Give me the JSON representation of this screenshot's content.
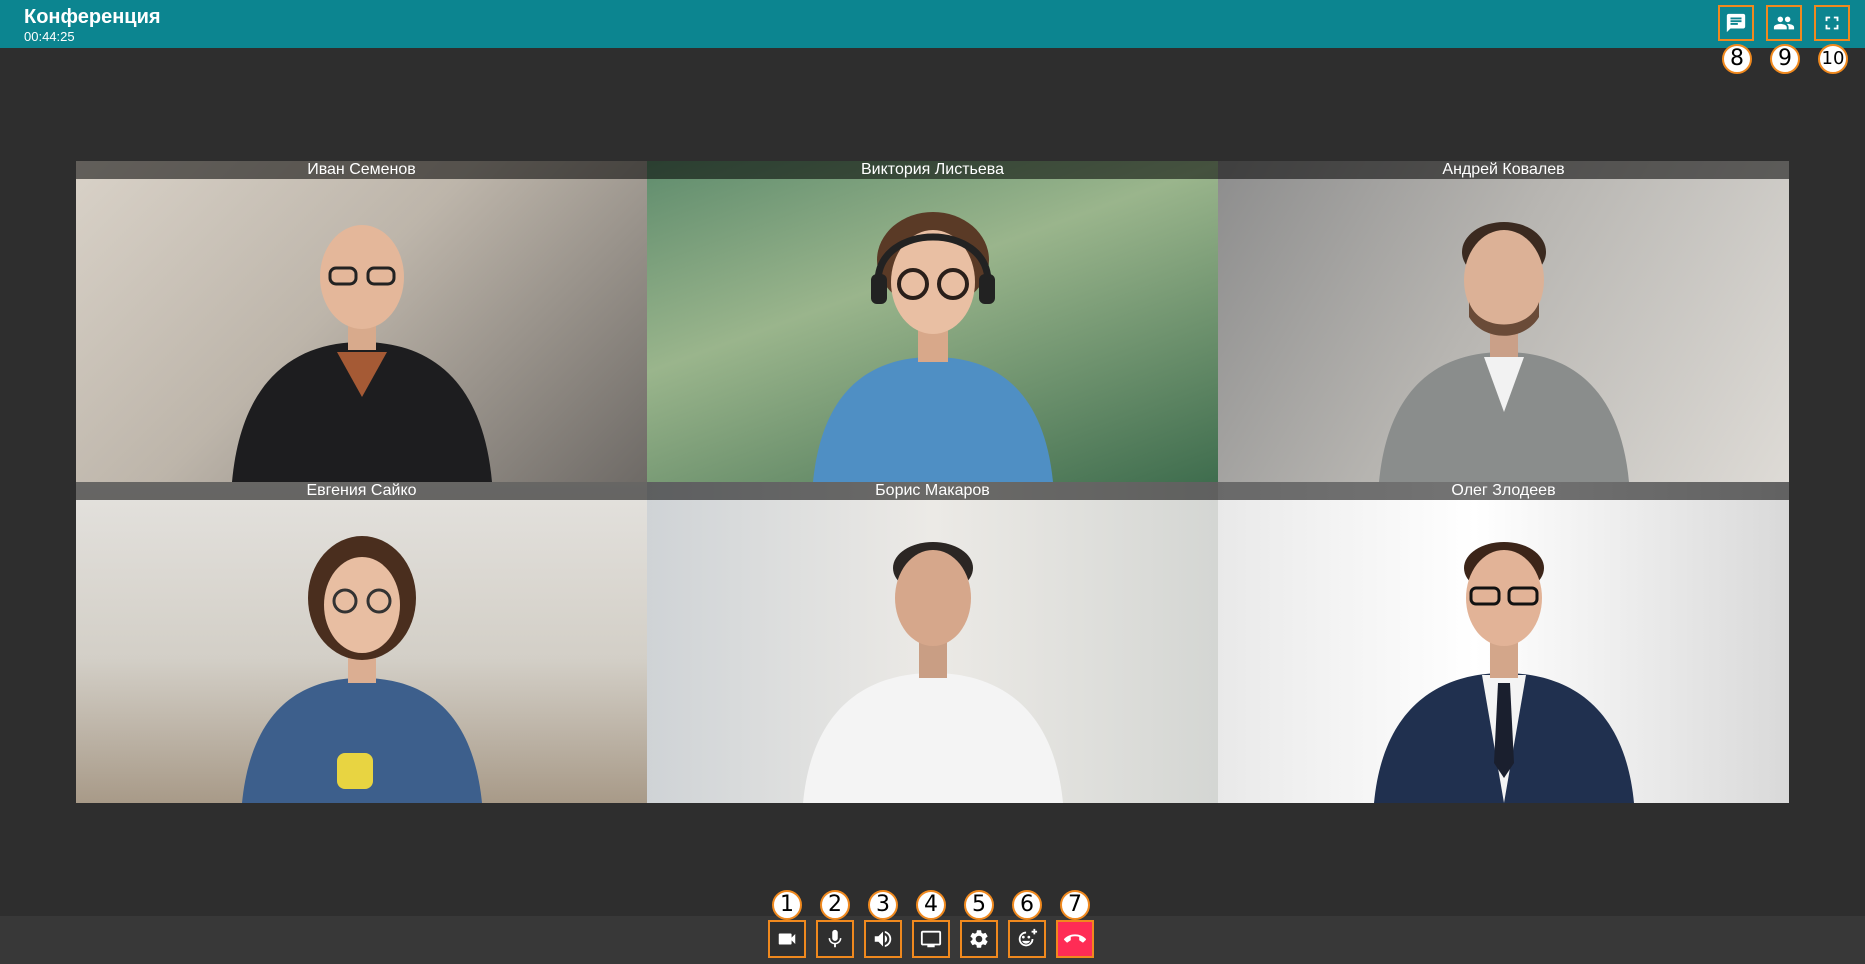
{
  "header": {
    "title": "Конференция",
    "elapsed": "00:44:25",
    "buttons": [
      {
        "id": "chat",
        "icon": "chat-icon",
        "marker": "8"
      },
      {
        "id": "participants",
        "icon": "people-icon",
        "marker": "9"
      },
      {
        "id": "fullscreen",
        "icon": "fullscreen-icon",
        "marker": "10"
      }
    ]
  },
  "participants": [
    {
      "name": "Иван Семенов"
    },
    {
      "name": "Виктория Листьева"
    },
    {
      "name": "Андрей Ковалев"
    },
    {
      "name": "Евгения Сайко"
    },
    {
      "name": "Борис Макаров"
    },
    {
      "name": "Олег Злодеев"
    }
  ],
  "controls": [
    {
      "id": "camera",
      "icon": "camera-icon",
      "marker": "1"
    },
    {
      "id": "microphone",
      "icon": "microphone-icon",
      "marker": "2"
    },
    {
      "id": "volume",
      "icon": "volume-icon",
      "marker": "3"
    },
    {
      "id": "screen-share",
      "icon": "monitor-icon",
      "marker": "4"
    },
    {
      "id": "settings",
      "icon": "gear-icon",
      "marker": "5"
    },
    {
      "id": "reactions",
      "icon": "emoji-add-icon",
      "marker": "6"
    },
    {
      "id": "hang-up",
      "icon": "phone-hangup-icon",
      "marker": "7"
    }
  ],
  "colors": {
    "header_bg": "#0c8590",
    "stage_bg": "#2e2e2e",
    "toolbar_bg": "#383838",
    "highlight": "#f0891e",
    "hangup": "#ff2c55"
  }
}
